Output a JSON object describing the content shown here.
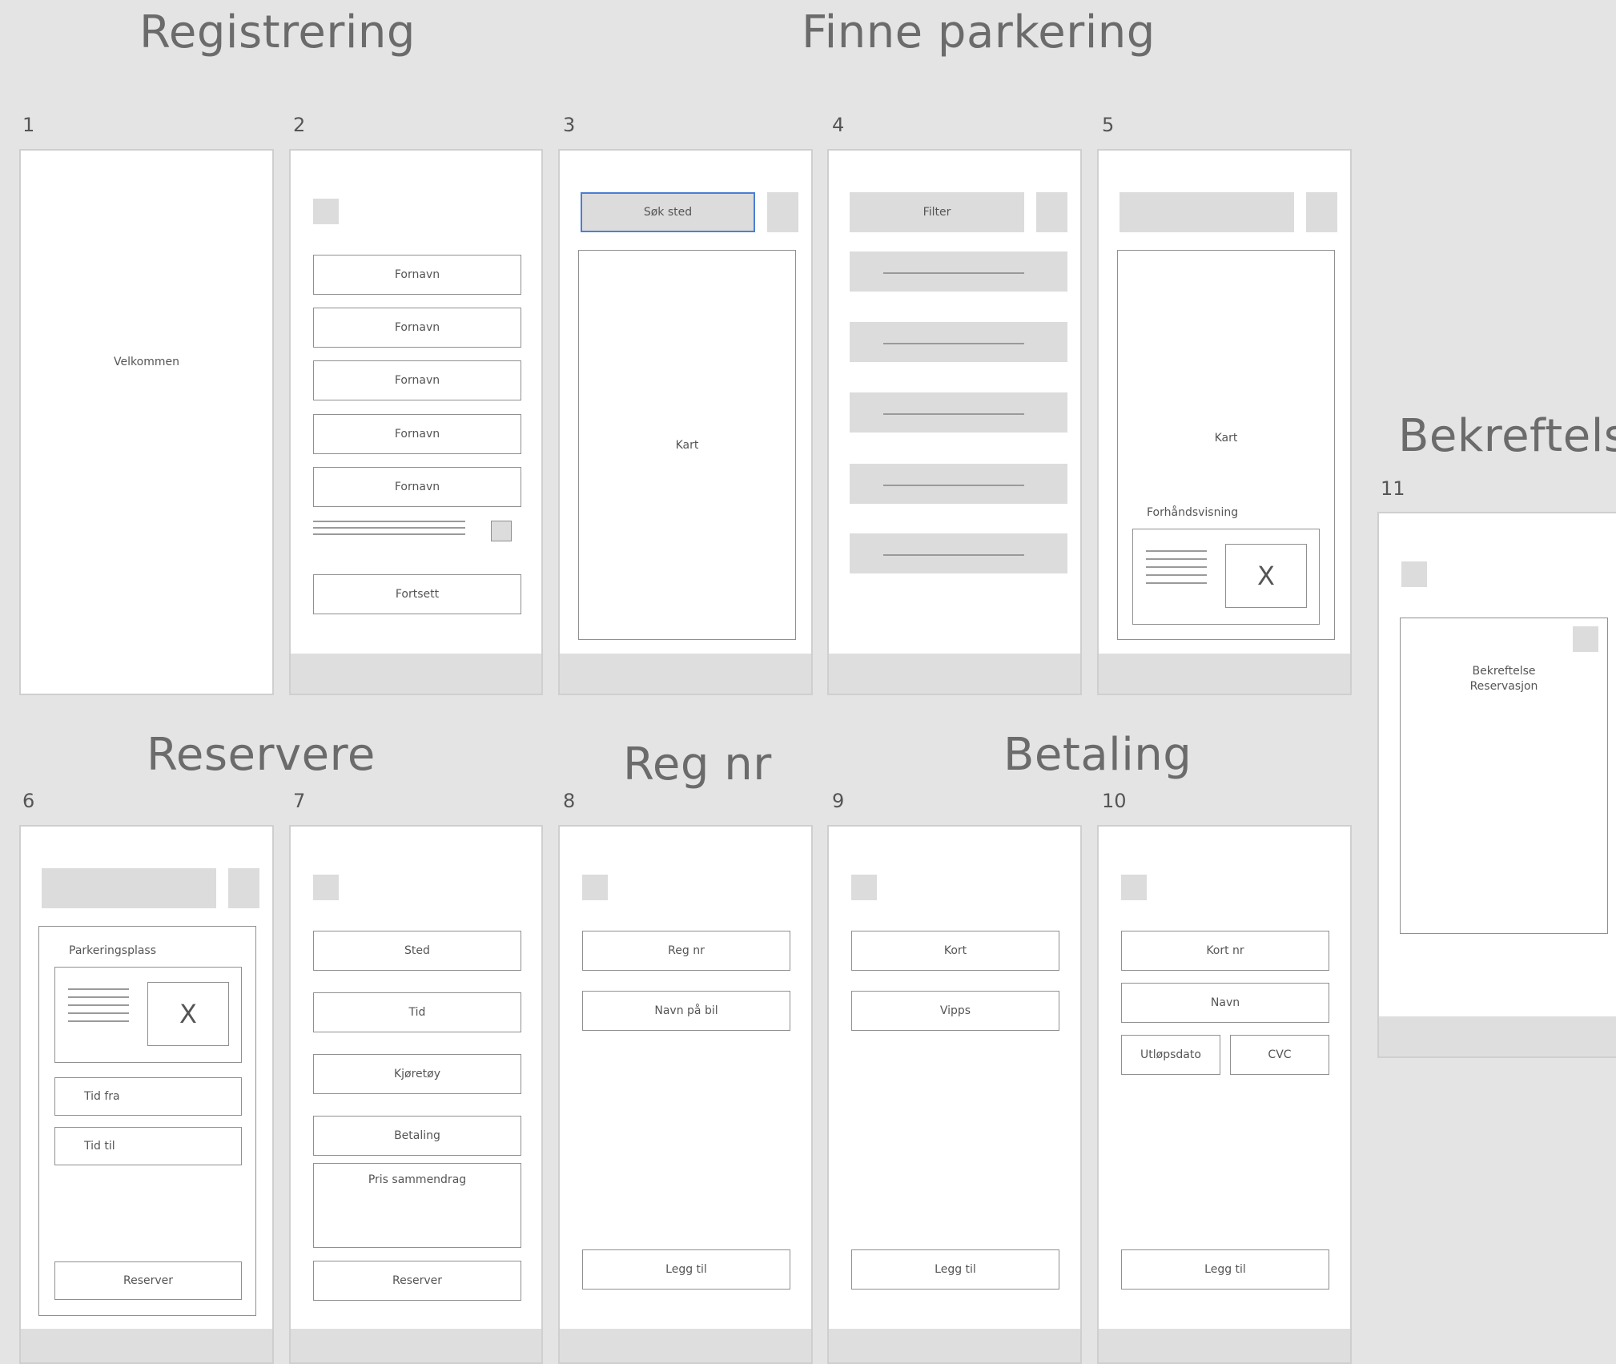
{
  "sections": {
    "registrering": "Registrering",
    "finne_parkering": "Finne parkering",
    "bekreftelse": "Bekreftelse",
    "reservere": "Reservere",
    "reg_nr": "Reg nr",
    "betaling": "Betaling"
  },
  "frames": [
    {
      "num": "1"
    },
    {
      "num": "2"
    },
    {
      "num": "3"
    },
    {
      "num": "4"
    },
    {
      "num": "5"
    },
    {
      "num": "6"
    },
    {
      "num": "7"
    },
    {
      "num": "8"
    },
    {
      "num": "9"
    },
    {
      "num": "10"
    },
    {
      "num": "11"
    }
  ],
  "f1": {
    "welcome": "Velkommen"
  },
  "f2": {
    "fields": [
      "Fornavn",
      "Fornavn",
      "Fornavn",
      "Fornavn",
      "Fornavn"
    ],
    "continue": "Fortsett"
  },
  "f3": {
    "search": "Søk sted",
    "map": "Kart"
  },
  "f4": {
    "filter": "Filter"
  },
  "f5": {
    "map": "Kart",
    "preview_label": "Forhåndsvisning",
    "close": "X"
  },
  "f6": {
    "spot_label": "Parkeringsplass",
    "close": "X",
    "time_from": "Tid fra",
    "time_to": "Tid til",
    "reserve": "Reserver"
  },
  "f7": {
    "fields": [
      "Sted",
      "Tid",
      "Kjøretøy",
      "Betaling"
    ],
    "summary": "Pris sammendrag",
    "reserve": "Reserver"
  },
  "f8": {
    "reg_nr": "Reg nr",
    "car_name": "Navn på bil",
    "add": "Legg til"
  },
  "f9": {
    "card": "Kort",
    "vipps": "Vipps",
    "add": "Legg til"
  },
  "f10": {
    "card_nr": "Kort nr",
    "name": "Navn",
    "expiry": "Utløpsdato",
    "cvc": "CVC",
    "add": "Legg til"
  },
  "f11": {
    "confirm_line1": "Bekreftelse",
    "confirm_line2": "Reservasjon"
  }
}
